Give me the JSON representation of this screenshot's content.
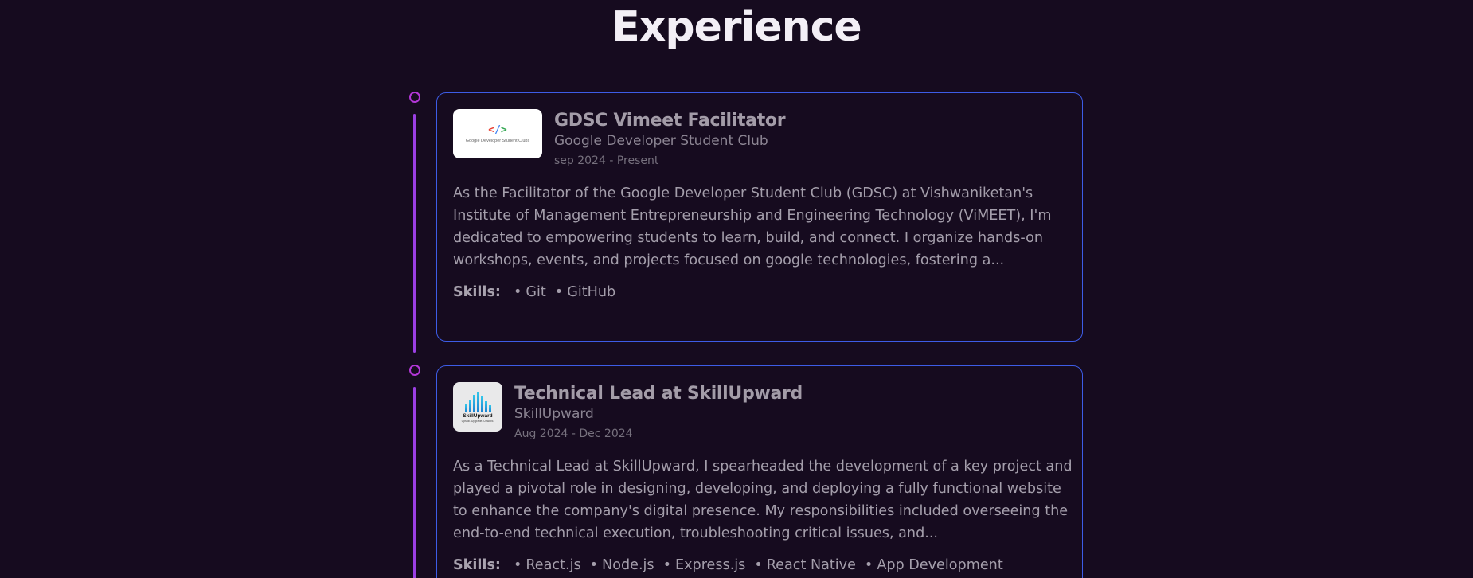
{
  "section": {
    "title": "Experience"
  },
  "experiences": [
    {
      "title": "GDSC Vimeet Facilitator",
      "company": "Google Developer Student Club",
      "dates": "sep 2024 - Present",
      "logo_text": "Google Developer Student Clubs",
      "description": "As the Facilitator of the Google Developer Student Club (GDSC) at Vishwaniketan's Institute of Management Entrepreneurship and Engineering Technology (ViMEET), I'm dedicated to empowering students to learn, build, and connect. I organize hands-on workshops, events, and projects focused on google technologies, fostering a...",
      "skills_label": "Skills:",
      "skills": [
        "Git",
        "GitHub"
      ]
    },
    {
      "title": "Technical Lead at SkillUpward",
      "company": "SkillUpward",
      "dates": "Aug 2024 - Dec 2024",
      "logo_text": "SkillUpward",
      "logo_tagline": "Upskill. Upgrade. Upward.",
      "description": "As a Technical Lead at SkillUpward, I spearheaded the development of a key project and played a pivotal role in designing, developing, and deploying a fully functional website to enhance the company's digital presence. My responsibilities included overseeing the end-to-end technical execution, troubleshooting critical issues, and...",
      "skills_label": "Skills:",
      "skills": [
        "React.js",
        "Node.js",
        "Express.js",
        "React Native",
        "App Development"
      ]
    }
  ],
  "colors": {
    "background": "#160b1f",
    "card_border": "#3d5ce6",
    "timeline": "#9b3fe4",
    "timeline_dot": "#b437d8",
    "title": "#f3eff6"
  },
  "icons": [
    "gdsc-logo",
    "skillupward-logo",
    "timeline-dot-icon"
  ]
}
